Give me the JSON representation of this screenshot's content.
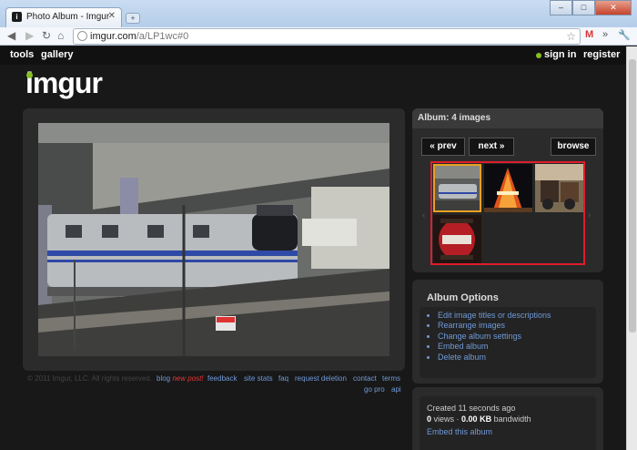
{
  "browser": {
    "tab_title": "Photo Album - Imgur",
    "url_host": "imgur.com",
    "url_path": "/a/LP1wc#0",
    "gmail_badge": "M"
  },
  "nav": {
    "tools": "tools",
    "gallery": "gallery",
    "sign_in": "sign in",
    "register": "register"
  },
  "logo": "imgur",
  "album": {
    "header": "Album: 4 images",
    "prev": "« prev",
    "next": "next »",
    "browse": "browse"
  },
  "options": {
    "title": "Album Options",
    "items": [
      "Edit image titles or descriptions",
      "Rearrange images",
      "Change album settings",
      "Embed album",
      "Delete album"
    ]
  },
  "info": {
    "created": "Created 11 seconds ago",
    "views_count": "0",
    "views_label": "views",
    "bandwidth_value": "0.00 KB",
    "bandwidth_label": "bandwidth",
    "embed": "Embed this album"
  },
  "footer": {
    "copyright": "© 2011 Imgur, LLC. All rights reserved.",
    "blog": "blog",
    "new_post": "new post!",
    "feedback": "feedback",
    "site_stats": "site stats",
    "faq": "faq",
    "request_deletion": "request deletion",
    "contact": "contact",
    "terms": "terms",
    "go_pro": "go pro",
    "api": "api"
  },
  "colors": {
    "accent_green": "#85bf25",
    "link_blue": "#6f9ad8",
    "selection_red": "#e01c2c"
  }
}
